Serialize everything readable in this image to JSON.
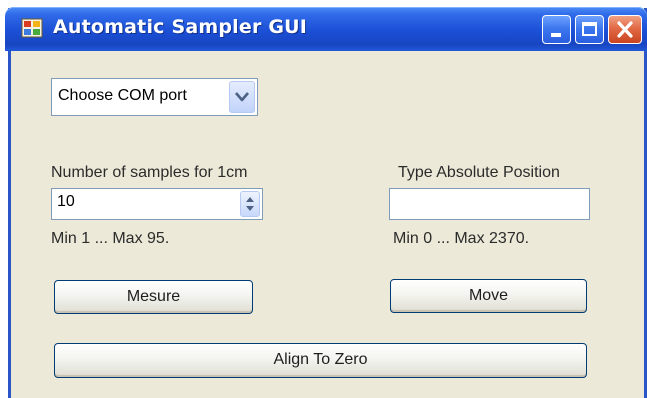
{
  "window": {
    "title": "Automatic Sampler GUI",
    "icon": "app-window-icon"
  },
  "titlebar_buttons": {
    "minimize_icon": "minimize-icon",
    "maximize_icon": "maximize-icon",
    "close_icon": "close-icon"
  },
  "com_port": {
    "selected": "Choose COM port",
    "dropdown_icon": "chevron-down-icon"
  },
  "samples": {
    "label": "Number of samples for 1cm",
    "value": "10",
    "range": "Min 1 ... Max 95.",
    "spinner_icon": "up-down-spinner-icon"
  },
  "position": {
    "label": "Type Absolute Position",
    "value": "",
    "range": "Min 0 ... Max 2370."
  },
  "buttons": {
    "mesure": "Mesure",
    "move": "Move",
    "align": "Align To Zero"
  },
  "colors": {
    "title_bar": "#1b4fd6",
    "window_bg": "#ece9d8",
    "close_button": "#e26a45"
  }
}
